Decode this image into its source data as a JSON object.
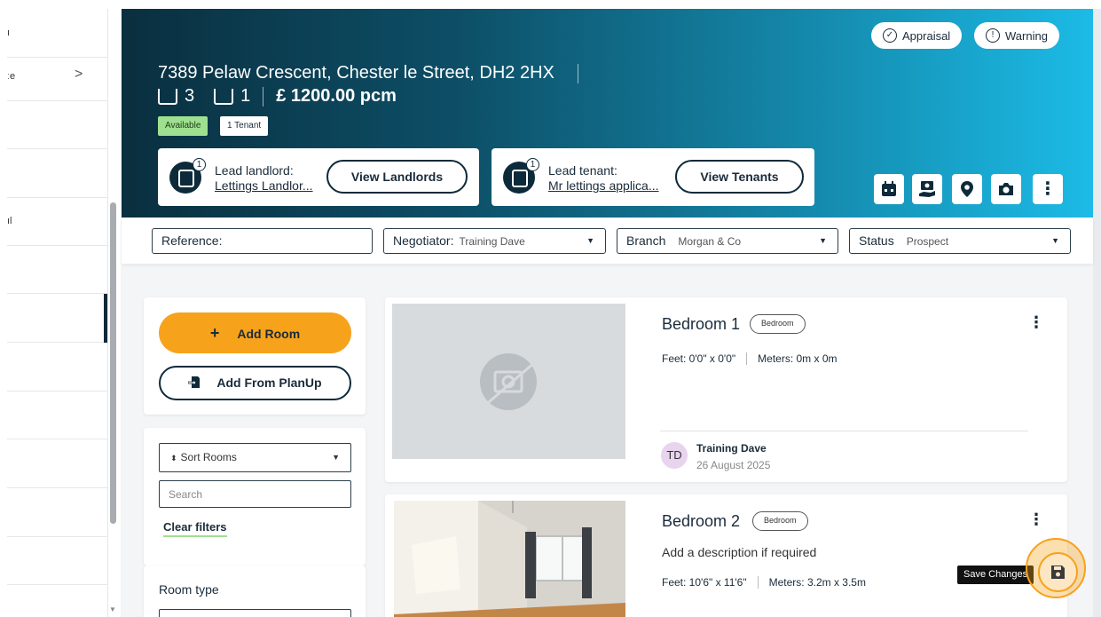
{
  "sidebar": {
    "items": [
      {
        "label": "ı",
        "chevron": false
      },
      {
        "label": "ːe",
        "chevron": true
      },
      {
        "label": "",
        "chevron": false
      },
      {
        "label": "",
        "chevron": false
      },
      {
        "label": "ıl",
        "chevron": false
      },
      {
        "label": "",
        "chevron": false
      },
      {
        "label": "",
        "chevron": false
      },
      {
        "label": "",
        "chevron": false
      },
      {
        "label": "",
        "chevron": false
      },
      {
        "label": "",
        "chevron": false
      },
      {
        "label": "",
        "chevron": false
      },
      {
        "label": "",
        "chevron": false
      }
    ],
    "chevron_glyph": ">",
    "scroll_down_glyph": "▼"
  },
  "hero": {
    "pills": {
      "appraisal": "Appraisal",
      "warning": "Warning"
    },
    "address": "7389 Pelaw Crescent, Chester le Street, DH2 2HX",
    "bedrooms": "3",
    "bathrooms": "1",
    "rent": "£ 1200.00 pcm",
    "tags": {
      "status": "Available",
      "tenants": "1 Tenant"
    },
    "landlord": {
      "count": "1",
      "role": "Lead landlord:",
      "name": "Lettings Landlor...",
      "button": "View Landlords"
    },
    "tenant": {
      "count": "1",
      "role": "Lead tenant:",
      "name": "Mr lettings applica...",
      "button": "View Tenants"
    },
    "tools": [
      "calendar-icon",
      "hand-money-icon",
      "map-pin-icon",
      "camera-icon",
      "more-vertical-icon"
    ],
    "colors": {
      "gradient_start": "#0a2f3f",
      "gradient_end": "#1cbbe6"
    }
  },
  "filters": {
    "reference": {
      "label": "Reference:",
      "value": ""
    },
    "negotiator": {
      "label": "Negotiator:",
      "value": "Training Dave"
    },
    "branch": {
      "label": "Branch",
      "value": "Morgan & Co"
    },
    "status": {
      "label": "Status",
      "value": "Prospect"
    },
    "caret": "▼"
  },
  "left_panel": {
    "add_room": "Add Room",
    "add_plus": "+",
    "add_from_planup": "Add From PlanUp",
    "sort_rooms": "Sort Rooms",
    "search_placeholder": "Search",
    "clear_filters": "Clear filters",
    "room_type": "Room type"
  },
  "rooms": [
    {
      "name": "Bedroom 1",
      "chip": "Bedroom",
      "feet": "Feet: 0'0\" x 0'0\"",
      "meters": "Meters: 0m x 0m",
      "user_initials": "TD",
      "user_name": "Training Dave",
      "date": "26 August 2025",
      "has_photo": false
    },
    {
      "name": "Bedroom 2",
      "chip": "Bedroom",
      "description": "Add a description if required",
      "feet": "Feet: 10'6\" x 11'6\"",
      "meters": "Meters: 3.2m x 3.5m",
      "has_photo": true
    }
  ],
  "kebab_glyph": "⋮",
  "save": {
    "tooltip": "Save Changes",
    "accent": "#f7a21b"
  }
}
